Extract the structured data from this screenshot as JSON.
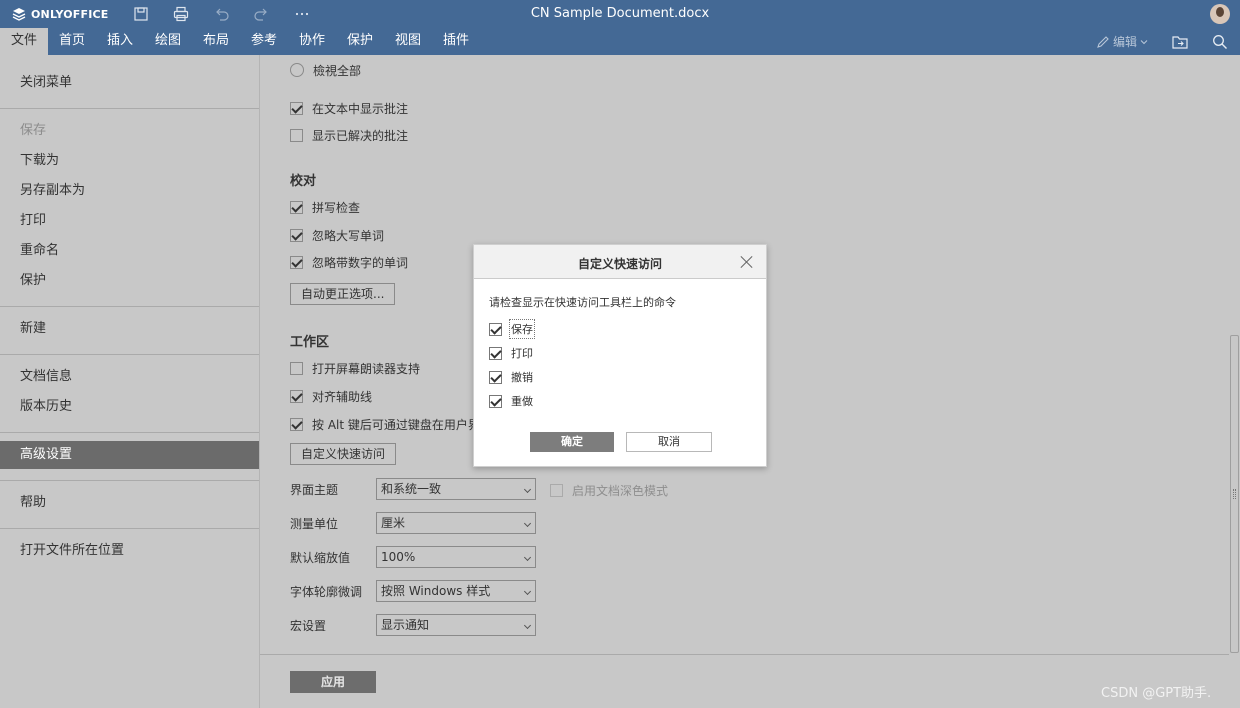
{
  "app": {
    "logo_text": "ONLYOFFICE",
    "doc_title": "CN Sample Document.docx"
  },
  "menu_tabs": [
    "文件",
    "首页",
    "插入",
    "绘图",
    "布局",
    "参考",
    "协作",
    "保护",
    "视图",
    "插件"
  ],
  "toolbar": {
    "edit_label": "编辑"
  },
  "left_panel": {
    "close_menu": "关闭菜单",
    "save": "保存",
    "download_as": "下载为",
    "save_copy_as": "另存副本为",
    "print": "打印",
    "rename": "重命名",
    "protect": "保护",
    "new": "新建",
    "doc_info": "文档信息",
    "version_history": "版本历史",
    "advanced_settings": "高级设置",
    "help": "帮助",
    "open_file_location": "打开文件所在位置"
  },
  "settings": {
    "view_all": "檢視全部",
    "show_comments_in_text": "在文本中显示批注",
    "show_resolved_comments": "显示已解决的批注",
    "proofing_title": "校对",
    "spell_check": "拼写检查",
    "ignore_uppercase": "忽略大写单词",
    "ignore_numbers": "忽略带数字的单词",
    "autocorrect_btn": "自动更正选项...",
    "workspace_title": "工作区",
    "screen_reader": "打开屏幕朗读器支持",
    "align_guides": "对齐辅助线",
    "alt_key": "按 Alt 键后可通过键盘在用户界面",
    "customize_quick_access_btn": "自定义快速访问",
    "theme_label": "界面主题",
    "theme_value": "和系统一致",
    "dark_mode_label": "启用文档深色模式",
    "unit_label": "测量单位",
    "unit_value": "厘米",
    "zoom_label": "默认缩放值",
    "zoom_value": "100%",
    "hinting_label": "字体轮廓微调",
    "hinting_value": "按照 Windows 样式",
    "macros_label": "宏设置",
    "macros_value": "显示通知",
    "apply_btn": "应用"
  },
  "dialog": {
    "title": "自定义快速访问",
    "description": "请检查显示在快速访问工具栏上的命令",
    "options": [
      {
        "label": "保存",
        "checked": true
      },
      {
        "label": "打印",
        "checked": true
      },
      {
        "label": "撤销",
        "checked": true
      },
      {
        "label": "重做",
        "checked": true
      }
    ],
    "ok": "确定",
    "cancel": "取消"
  },
  "watermark": "CSDN @GPT助手."
}
